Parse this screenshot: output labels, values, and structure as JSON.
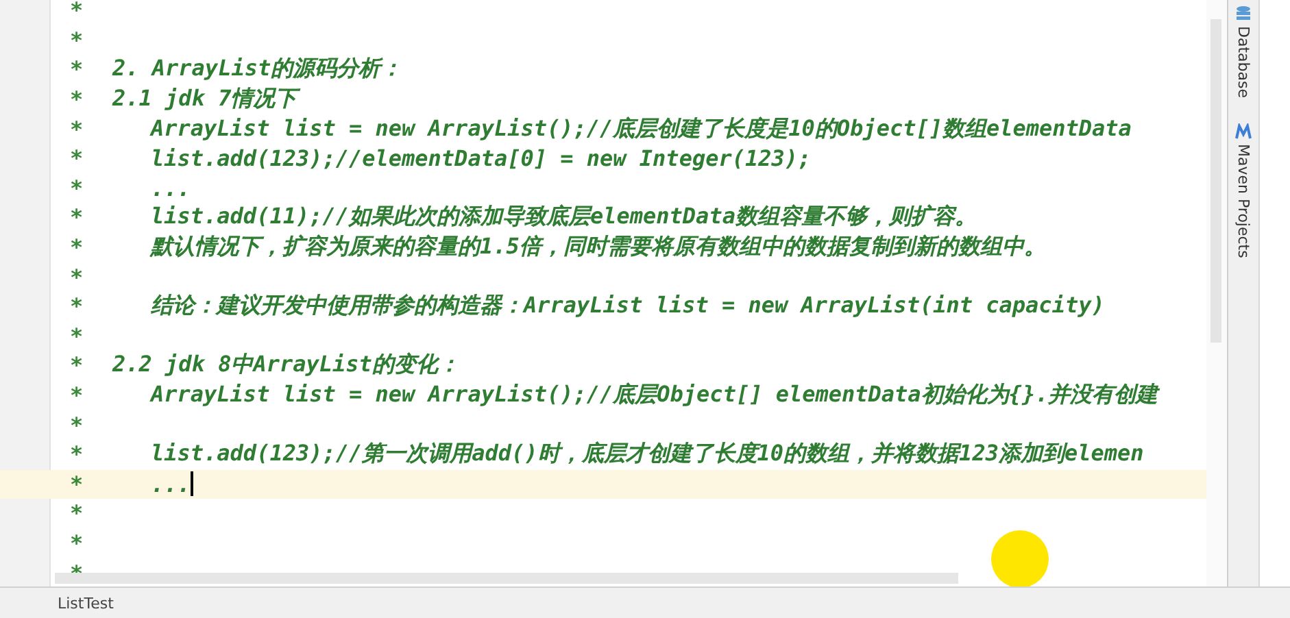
{
  "editor": {
    "lines": [
      {
        "marker": "*",
        "kind": "blank",
        "current": false
      },
      {
        "marker": "*",
        "kind": "blank",
        "current": false
      },
      {
        "marker": "*",
        "kind": "heading",
        "text": "2. ArrayList的源码分析：",
        "current": false
      },
      {
        "marker": "*",
        "kind": "heading",
        "text": "2.1 jdk 7情况下",
        "current": false
      },
      {
        "marker": "*",
        "kind": "code",
        "text": "ArrayList list = new ArrayList();//底层创建了长度是10的Object[]数组elementData",
        "current": false
      },
      {
        "marker": "*",
        "kind": "code",
        "text": "list.add(123);//elementData[0] = new Integer(123);",
        "current": false
      },
      {
        "marker": "*",
        "kind": "code",
        "text": "...",
        "current": false
      },
      {
        "marker": "*",
        "kind": "code",
        "text": "list.add(11);//如果此次的添加导致底层elementData数组容量不够，则扩容。",
        "current": false
      },
      {
        "marker": "*",
        "kind": "code",
        "text": "默认情况下，扩容为原来的容量的1.5倍，同时需要将原有数组中的数据复制到新的数组中。",
        "current": false
      },
      {
        "marker": "*",
        "kind": "blank",
        "current": false
      },
      {
        "marker": "*",
        "kind": "code",
        "text": "结论：建议开发中使用带参的构造器：ArrayList list = new ArrayList(int capacity)",
        "current": false
      },
      {
        "marker": "*",
        "kind": "blank",
        "current": false
      },
      {
        "marker": "*",
        "kind": "heading",
        "text": "2.2 jdk 8中ArrayList的变化：",
        "current": false
      },
      {
        "marker": "*",
        "kind": "code",
        "text": "ArrayList list = new ArrayList();//底层Object[] elementData初始化为{}.并没有创建",
        "current": false
      },
      {
        "marker": "*",
        "kind": "blank",
        "current": false
      },
      {
        "marker": "*",
        "kind": "code",
        "text": "list.add(123);//第一次调用add()时，底层才创建了长度10的数组，并将数据123添加到elemen",
        "current": false
      },
      {
        "marker": "*",
        "kind": "code",
        "text": "...",
        "current": true
      },
      {
        "marker": "*",
        "kind": "blank",
        "current": false
      },
      {
        "marker": "*",
        "kind": "blank",
        "current": false
      },
      {
        "marker": "*",
        "kind": "blank",
        "current": false
      }
    ]
  },
  "tool_windows": [
    {
      "label": "Database"
    },
    {
      "label": "Maven Projects"
    }
  ],
  "status_bar": {
    "file": "ListTest"
  }
}
